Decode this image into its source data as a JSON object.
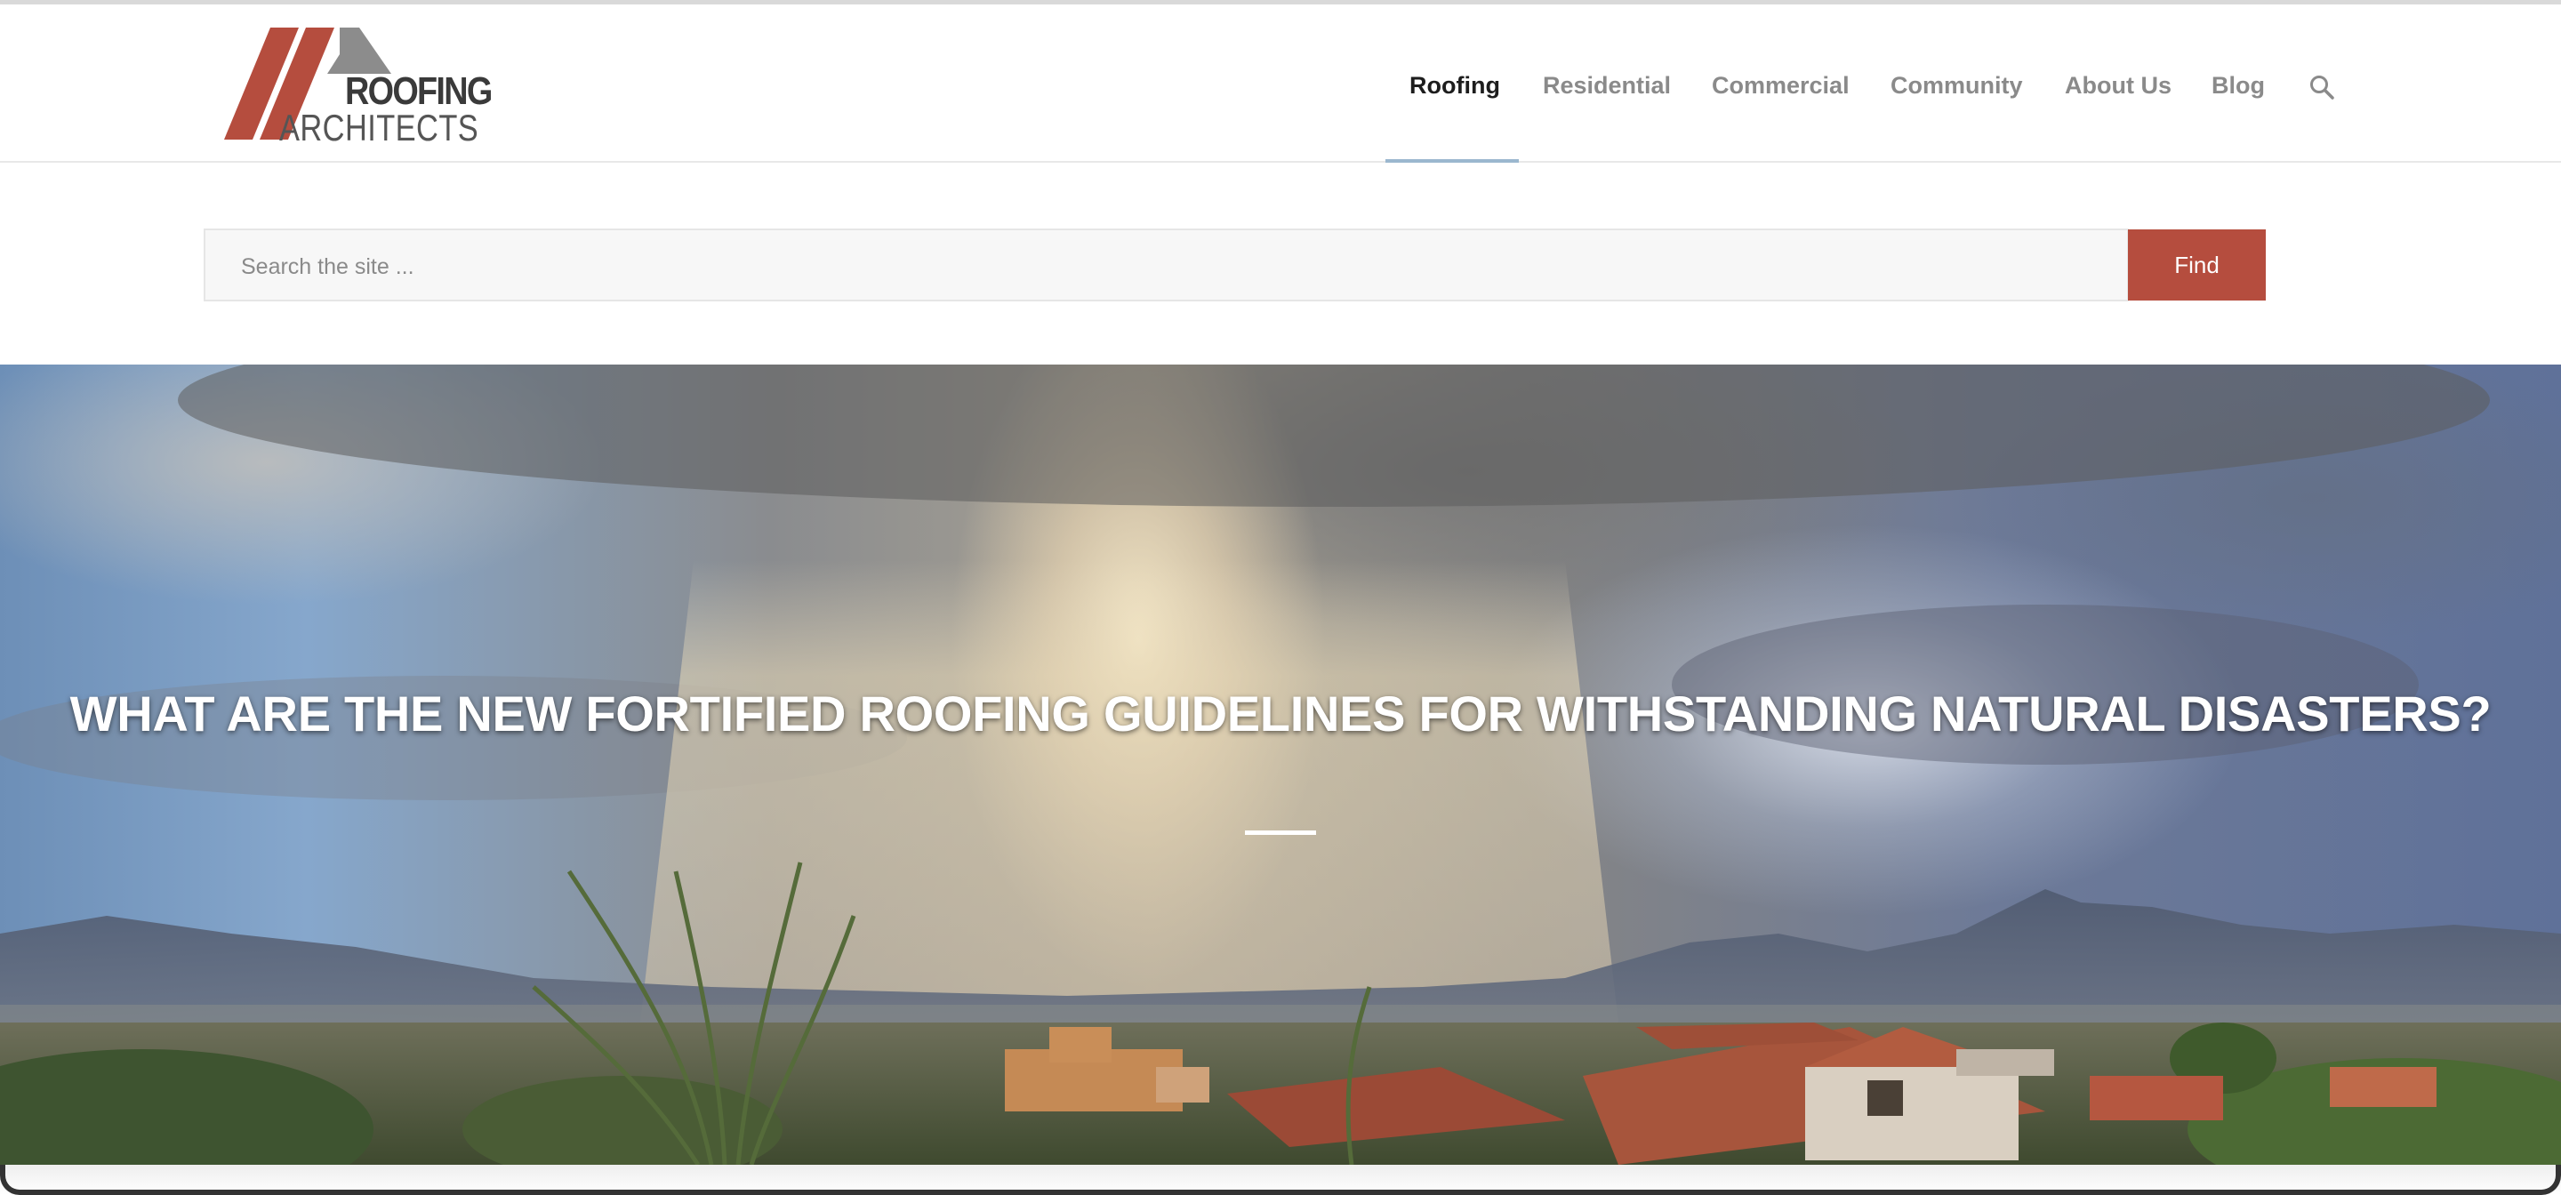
{
  "brand": {
    "name_line_1": "ROOFING",
    "name_line_2": "ARCHITECTS",
    "colors": {
      "red": "#b54d3e",
      "gray": "#8c8c8c",
      "dark": "#3a3a3a"
    }
  },
  "nav": {
    "items": [
      {
        "label": "Roofing",
        "active": true
      },
      {
        "label": "Residential",
        "active": false
      },
      {
        "label": "Commercial",
        "active": false
      },
      {
        "label": "Community",
        "active": false
      },
      {
        "label": "About Us",
        "active": false
      },
      {
        "label": "Blog",
        "active": false
      }
    ],
    "search_icon": "search-icon",
    "active_underline_color": "#9bb7cf"
  },
  "search": {
    "placeholder": "Search the site ...",
    "button_label": "Find",
    "button_color": "#b54d3e"
  },
  "hero": {
    "title": "WHAT ARE THE NEW FORTIFIED ROOFING GUIDELINES FOR WITHSTANDING NATURAL DISASTERS?"
  }
}
